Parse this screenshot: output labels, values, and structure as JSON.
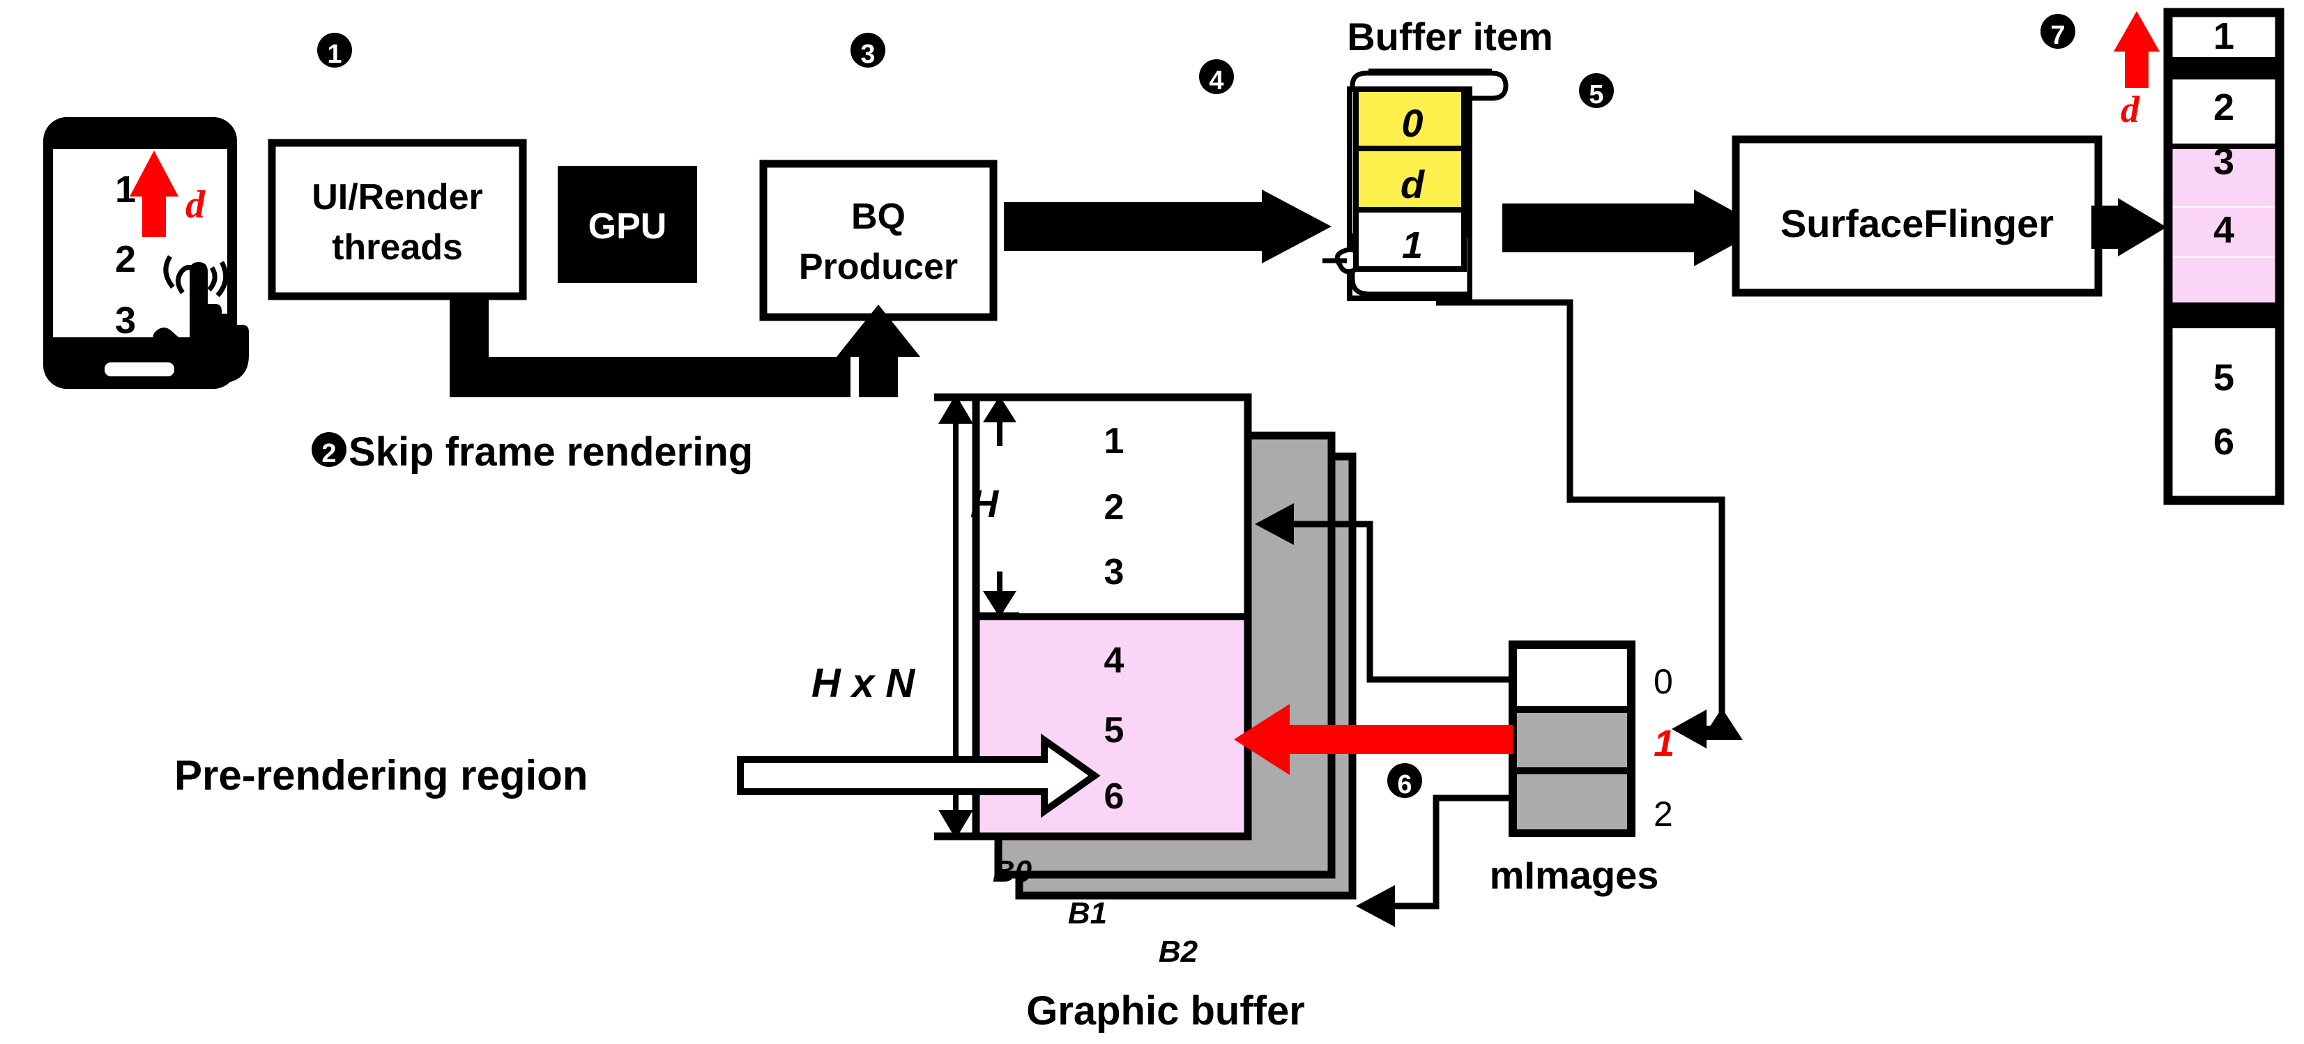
{
  "diagram": {
    "title_labels": {
      "buffer_item": "Buffer item",
      "graphic_buffer": "Graphic buffer",
      "mimages": "mImages",
      "pre_rendering_region": "Pre-rendering region",
      "skip_frame_rendering": "Skip frame rendering"
    },
    "steps": {
      "s1": "❶",
      "s2": "❷",
      "s3": "❸",
      "s4": "❹",
      "s5": "❺",
      "s6": "❻",
      "s7": "❼"
    },
    "boxes": {
      "ui_render_threads_line1": "UI/Render",
      "ui_render_threads_line2": "threads",
      "gpu": "GPU",
      "bq_producer_line1": "BQ",
      "bq_producer_line2": "Producer",
      "surfaceflinger": "SurfaceFlinger"
    },
    "phone_screen": {
      "rows": [
        "1",
        "2",
        "3"
      ],
      "delta_label": "d"
    },
    "buffer_item": {
      "cells": [
        {
          "value": "0",
          "fill": "#FFF04D"
        },
        {
          "value": "d",
          "fill": "#FFF04D"
        },
        {
          "value": "1",
          "fill": "#FFFFFF"
        }
      ]
    },
    "graphic_buffer": {
      "b0_rows_top": [
        "1",
        "2",
        "3"
      ],
      "b0_rows_bottom": [
        "4",
        "5",
        "6"
      ],
      "buffer_labels": [
        "B0",
        "B1",
        "B2"
      ],
      "dim_h": "H",
      "dim_hxn": "H x N"
    },
    "mimages": {
      "index_labels": [
        "0",
        "1",
        "2"
      ],
      "cell_fills": [
        "#FFFFFF",
        "#ABABAB",
        "#ABABAB"
      ],
      "highlighted_index": "1"
    },
    "display_column": {
      "rows_top": [
        "1"
      ],
      "rows_mid": [
        "2",
        "3"
      ],
      "rows_pink_a": [
        "4"
      ],
      "rows_pink_b": [
        "5",
        "6"
      ],
      "delta_label": "d"
    },
    "colors": {
      "yellow": "#FFF04D",
      "pink": "#FBD5F7",
      "gray": "#ABABAB",
      "red": "#FF0000",
      "black": "#000000",
      "white": "#FFFFFF"
    }
  }
}
